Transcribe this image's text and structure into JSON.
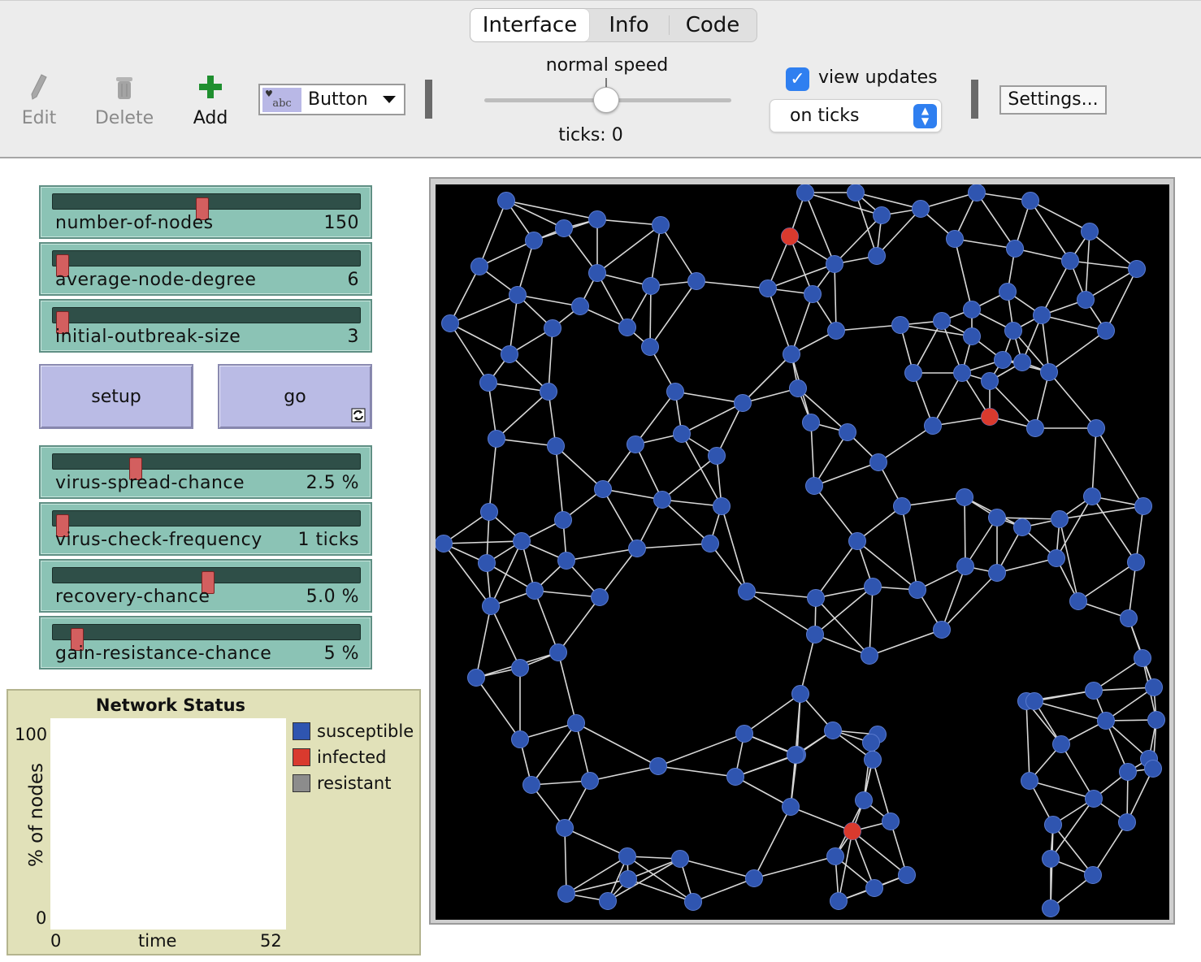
{
  "tabs": [
    "Interface",
    "Info",
    "Code"
  ],
  "toolbar": {
    "edit_label": "Edit",
    "delete_label": "Delete",
    "add_label": "Add",
    "widget_type": "Button",
    "widget_icon_text": "abc",
    "speed_label": "normal speed",
    "ticks_label": "ticks: 0",
    "view_updates_label": "view updates",
    "view_updates_checked": true,
    "update_mode": "on ticks",
    "settings_label": "Settings..."
  },
  "sliders": [
    {
      "name": "number-of-nodes",
      "value": "150",
      "fraction": 0.48
    },
    {
      "name": "average-node-degree",
      "value": "6",
      "fraction": 0.0
    },
    {
      "name": "initial-outbreak-size",
      "value": "3",
      "fraction": 0.0
    },
    {
      "name": "virus-spread-chance",
      "value": "2.5 %",
      "fraction": 0.25
    },
    {
      "name": "virus-check-frequency",
      "value": "1 ticks",
      "fraction": 0.0
    },
    {
      "name": "recovery-chance",
      "value": "5.0 %",
      "fraction": 0.5
    },
    {
      "name": "gain-resistance-chance",
      "value": "5 %",
      "fraction": 0.05
    }
  ],
  "buttons": {
    "setup": "setup",
    "go": "go",
    "go_forever_icon": "refresh-icon"
  },
  "plot": {
    "title": "Network Status",
    "ylabel": "% of nodes",
    "xlabel": "time",
    "ymax": "100",
    "ymin": "0",
    "xmin": "0",
    "xmax": "52",
    "legend": [
      {
        "label": "susceptible",
        "color": "#2f55b0"
      },
      {
        "label": "infected",
        "color": "#d93a2e"
      },
      {
        "label": "resistant",
        "color": "#8c8c8c"
      }
    ]
  },
  "view": {
    "background": "#000000",
    "susceptible_color": "#2f55b0",
    "infected_color": "#d93a2e",
    "susceptible_count": 147,
    "infected_count": 3,
    "resistant_count": 0
  }
}
